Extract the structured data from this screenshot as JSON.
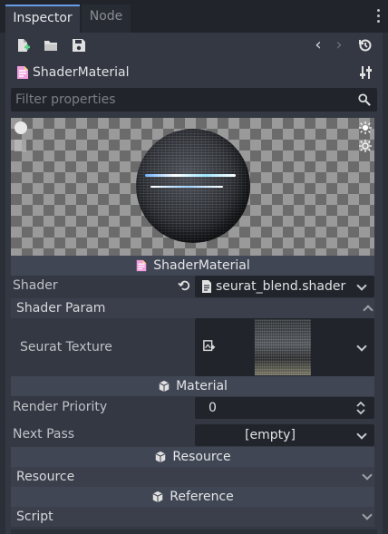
{
  "tabs": [
    {
      "label": "Inspector",
      "active": true
    },
    {
      "label": "Node",
      "active": false
    }
  ],
  "resource": {
    "title": "ShaderMaterial"
  },
  "filter": {
    "placeholder": "Filter properties"
  },
  "preview_footer": {
    "label": "ShaderMaterial"
  },
  "shader_row": {
    "label": "Shader",
    "value": "seurat_blend.shader"
  },
  "shader_param": {
    "label": "Shader Param"
  },
  "seurat_texture": {
    "label": "Seurat Texture"
  },
  "material_section": {
    "label": "Material"
  },
  "render_priority": {
    "label": "Render Priority",
    "value": "0"
  },
  "next_pass": {
    "label": "Next Pass",
    "value": "[empty]"
  },
  "resource_section": {
    "label": "Resource"
  },
  "resource_row": {
    "label": "Resource"
  },
  "reference_section": {
    "label": "Reference"
  },
  "script_row": {
    "label": "Script"
  },
  "colors": {
    "accent": "#699ce8",
    "panel": "#333843",
    "background": "#2b2f38"
  }
}
